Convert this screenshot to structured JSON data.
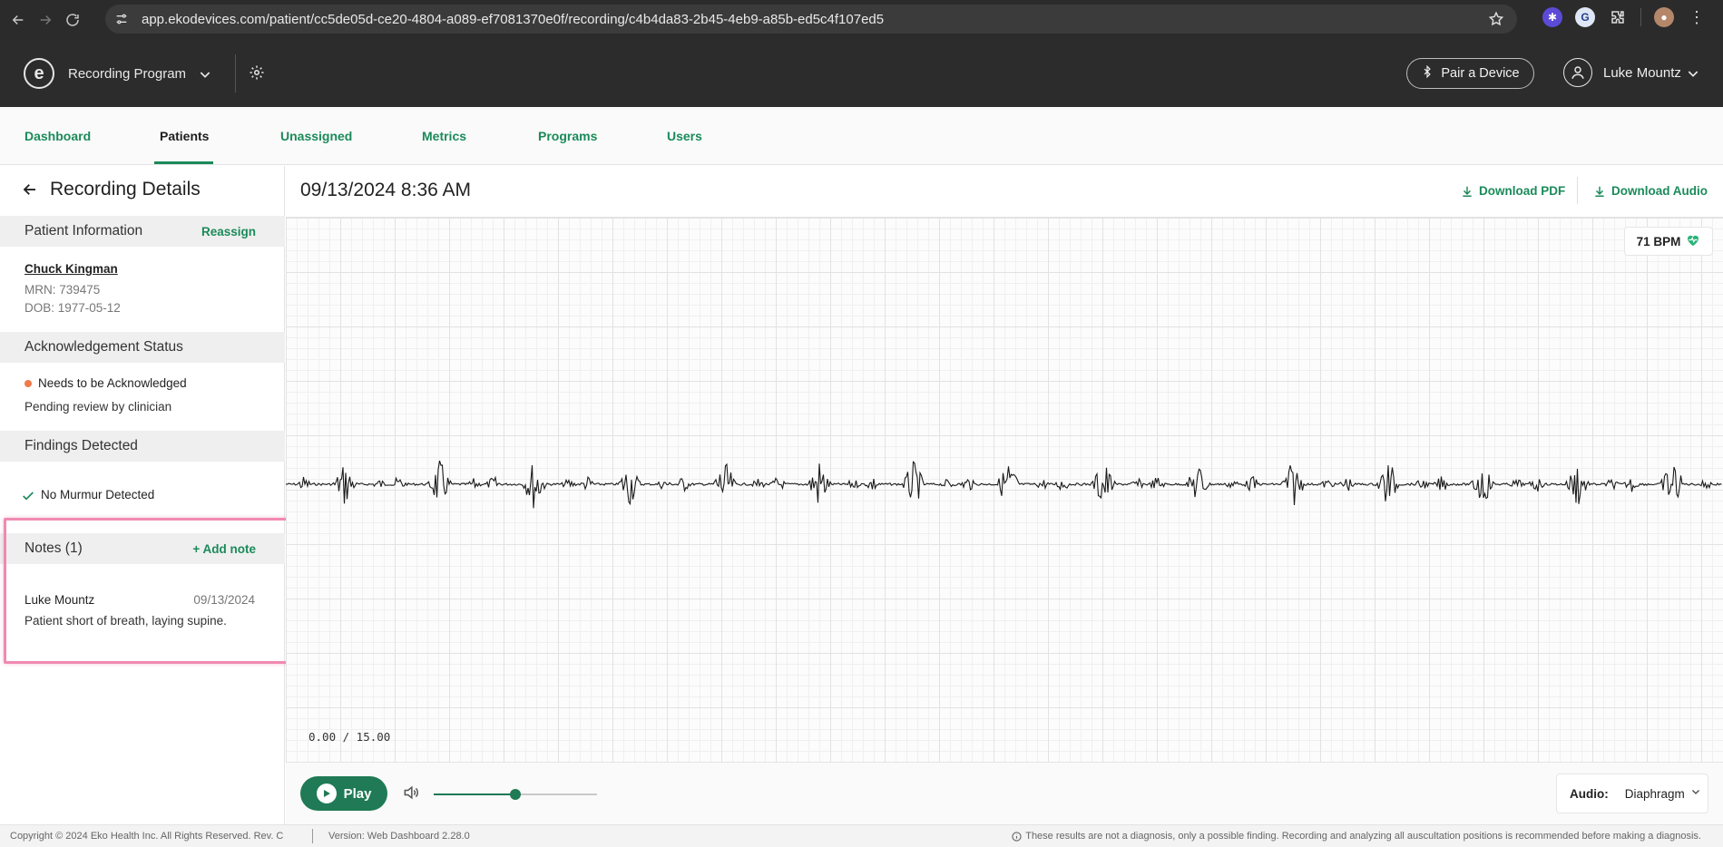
{
  "browser": {
    "url": "app.ekodevices.com/patient/cc5de05d-ce20-4804-a089-ef7081370e0f/recording/c4b4da83-2b45-4eb9-a85b-ed5c4f107ed5"
  },
  "header": {
    "program_label": "Recording Program",
    "pair_button_label": "Pair a Device",
    "user_name": "Luke Mountz"
  },
  "tabs": [
    {
      "label": "Dashboard",
      "active": false
    },
    {
      "label": "Patients",
      "active": true
    },
    {
      "label": "Unassigned",
      "active": false
    },
    {
      "label": "Metrics",
      "active": false
    },
    {
      "label": "Programs",
      "active": false
    },
    {
      "label": "Users",
      "active": false
    }
  ],
  "left_panel": {
    "title": "Recording Details",
    "patient_info": {
      "heading": "Patient Information",
      "action": "Reassign",
      "name": "Chuck Kingman",
      "mrn": "MRN: 739475",
      "dob": "DOB: 1977-05-12"
    },
    "acknowledgement": {
      "heading": "Acknowledgement Status",
      "status": "Needs to be Acknowledged",
      "detail": "Pending review by clinician",
      "status_color": "#f07a4a"
    },
    "findings": {
      "heading": "Findings Detected",
      "items": [
        "No Murmur Detected"
      ]
    },
    "notes": {
      "heading": "Notes (1)",
      "action": "+ Add note",
      "items": [
        {
          "author": "Luke Mountz",
          "date": "09/13/2024",
          "text": "Patient short of breath, laying supine."
        }
      ]
    }
  },
  "main": {
    "recording_datetime": "09/13/2024 8:36 AM",
    "download_pdf_label": "Download PDF",
    "download_audio_label": "Download Audio",
    "heart_rate": "71 BPM",
    "time_readout": "0.00 / 15.00",
    "play_label": "Play",
    "volume_level": 0.5,
    "audio_label": "Audio:",
    "audio_mode": "Diaphragm"
  },
  "footer": {
    "copyright": "Copyright © 2024 Eko Health Inc. All Rights Reserved. Rev. C",
    "version": "Version: Web Dashboard 2.28.0",
    "disclaimer": "These results are not a diagnosis, only a possible finding. Recording and analyzing all auscultation positions is recommended before making a diagnosis."
  },
  "colors": {
    "accent": "#1b8a5a",
    "header_bg": "#2c2c2c",
    "highlight": "#f08ab2"
  }
}
